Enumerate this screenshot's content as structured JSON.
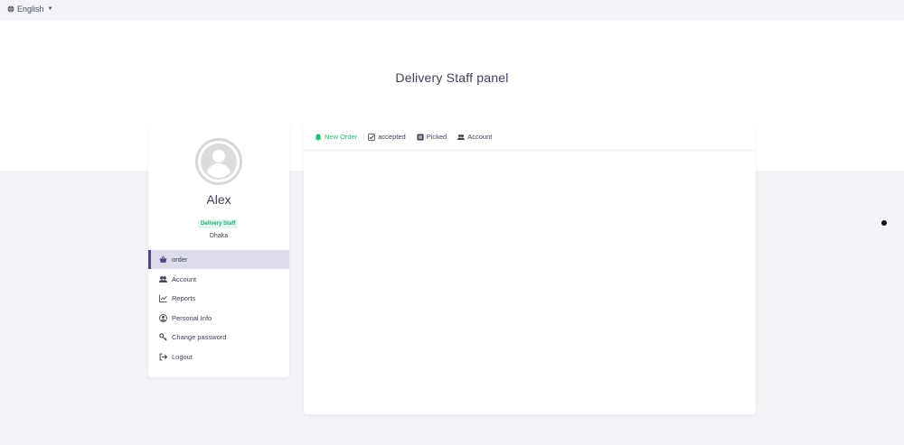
{
  "language": {
    "label": "English",
    "icon": "globe-icon"
  },
  "header": {
    "title": "Delivery Staff panel"
  },
  "profile": {
    "name": "Alex",
    "role": "Delivery Staff",
    "location": "Dhaka"
  },
  "menu": [
    {
      "label": "order",
      "icon": "basket-icon",
      "active": true
    },
    {
      "label": "Account",
      "icon": "users-icon"
    },
    {
      "label": "Reports",
      "icon": "chart-icon"
    },
    {
      "label": "Personal Info",
      "icon": "user-circle-icon"
    },
    {
      "label": "Change password",
      "icon": "key-icon"
    },
    {
      "label": "Logout",
      "icon": "logout-icon"
    }
  ],
  "tabs": [
    {
      "label": "New Order",
      "icon": "bell-icon",
      "active": true
    },
    {
      "label": "accepted",
      "icon": "check-square-icon"
    },
    {
      "label": "Picked",
      "icon": "box-icon"
    },
    {
      "label": "Account",
      "icon": "users-icon"
    }
  ],
  "colors": {
    "accent": "#1fbf6f",
    "active_menu_border": "#4b4a8f",
    "active_menu_bg": "#ddddea"
  }
}
